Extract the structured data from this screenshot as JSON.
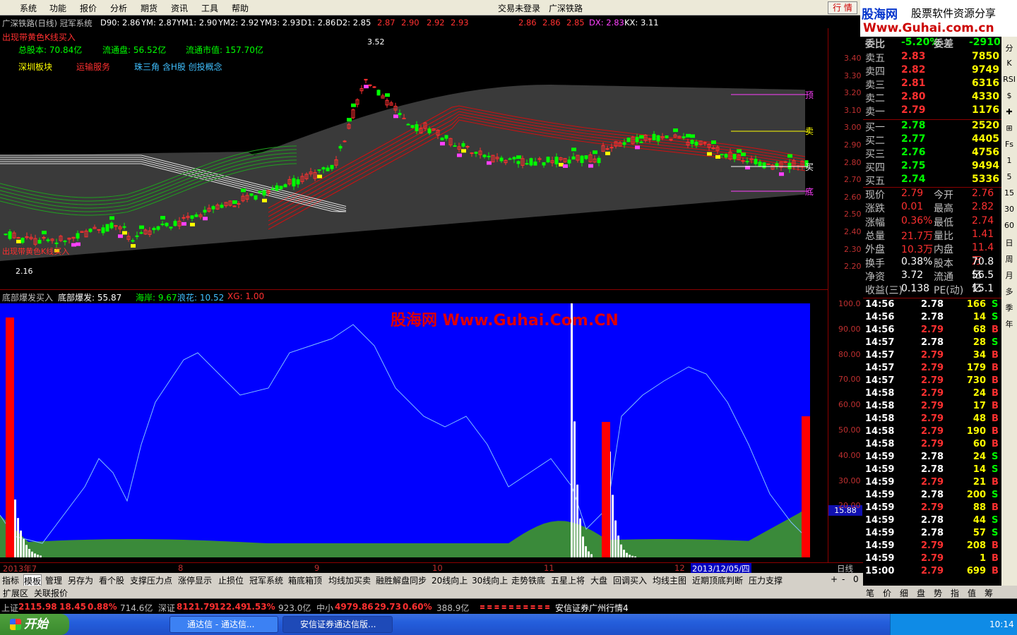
{
  "menu": {
    "items": [
      "系统",
      "功能",
      "报价",
      "分析",
      "期货",
      "资讯",
      "工具",
      "帮助"
    ],
    "status": "交易未登录",
    "stock": "广深铁路",
    "hq_button": "行 情",
    "win_buttons": "_ □ ×"
  },
  "logo": {
    "line1": "股海网",
    "line1b": "股票软件资源分享",
    "line2": "Www.Guhai.com.cn"
  },
  "chart_info": {
    "title": "广深铁路(日线) 冠军系统",
    "d90": "D90: 2.86",
    "ym": "YM: 2.87",
    "ym1": "YM1: 2.90",
    "ym2": "YM2: 2.92",
    "ym3": "YM3: 2.93",
    "d1": "D1: 2.86",
    "d2": "D2: 2.85",
    "r1": "2.87",
    "r2": "2.90",
    "r3": "2.92",
    "r4": "2.93",
    "r5": "2.86",
    "r6": "2.86",
    "r7": "2.85",
    "dx": "DX: 2.83",
    "kx": "KX: 3.11"
  },
  "chart_labels": {
    "k_alert": "出现带黄色K线买入",
    "k_alert2": "出现带黄色K线买入",
    "total_shares": "总股本: 70.84亿",
    "float_shares": "流通盘: 56.52亿",
    "float_mv": "流通市值: 157.70亿",
    "sector1": "深圳板块",
    "sector2": "运输服务",
    "concept": "珠三角 含H股 创投概念",
    "high": "3.52",
    "low": "2.16",
    "top": "顶",
    "sell": "卖",
    "buy": "买",
    "bottom": "底"
  },
  "price_axis": [
    "3.40",
    "3.30",
    "3.20",
    "3.10",
    "3.00",
    "2.90",
    "2.80",
    "2.70",
    "2.60",
    "2.50",
    "2.40",
    "2.30",
    "2.20"
  ],
  "sub_head": {
    "name": "底部爆发买入",
    "v1": "底部爆发: 55.87",
    "v2": "海岸: 9.67",
    "v3": "浪花: 10.52",
    "v4": "XG: 1.00"
  },
  "sub_axis": [
    "100.0",
    "90.00",
    "80.00",
    "70.00",
    "60.00",
    "50.00",
    "40.00",
    "30.00",
    "20.00"
  ],
  "sub_current": "15.88",
  "watermark": "股海网 Www.Guhai.Com.CN",
  "date_axis": {
    "y2013": "2013年7",
    "m8": "8",
    "m9": "9",
    "m10": "10",
    "m11": "11",
    "m12": "12",
    "cursor": "2013/12/05/四",
    "period": "日线"
  },
  "tabs": [
    "指标",
    "模板",
    "管理",
    "另存为",
    "看个股",
    "支撑压力点",
    "涨停显示",
    "止损位",
    "冠军系统",
    "箱底箱顶",
    "均线加买卖",
    "融胜解盘同步",
    "20线向上",
    "30线向上",
    "走势铁底",
    "五星上将",
    "大盘",
    "回调买入",
    "均线主图",
    "近期顶底判断",
    "压力支撑"
  ],
  "tab_ctrl": [
    "+",
    "-",
    "0"
  ],
  "expand": [
    "扩展区",
    "关联报价"
  ],
  "order_book": {
    "header": {
      "a": "委比",
      "b": "-5.20%",
      "c": "委差",
      "d": "-2910"
    },
    "sell": [
      {
        "n": "卖五",
        "p": "2.83",
        "v": "7850"
      },
      {
        "n": "卖四",
        "p": "2.82",
        "v": "9749"
      },
      {
        "n": "卖三",
        "p": "2.81",
        "v": "6316"
      },
      {
        "n": "卖二",
        "p": "2.80",
        "v": "4330"
      },
      {
        "n": "卖一",
        "p": "2.79",
        "v": "1176"
      }
    ],
    "buy": [
      {
        "n": "买一",
        "p": "2.78",
        "v": "2520"
      },
      {
        "n": "买二",
        "p": "2.77",
        "v": "4405"
      },
      {
        "n": "买三",
        "p": "2.76",
        "v": "4756"
      },
      {
        "n": "买四",
        "p": "2.75",
        "v": "9494"
      },
      {
        "n": "买五",
        "p": "2.74",
        "v": "5336"
      }
    ]
  },
  "stats": [
    {
      "a": "现价",
      "b": "2.79",
      "c": "今开",
      "d": "2.76"
    },
    {
      "a": "涨跌",
      "b": "0.01",
      "c": "最高",
      "d": "2.82"
    },
    {
      "a": "涨幅",
      "b": "0.36%",
      "c": "最低",
      "d": "2.74"
    },
    {
      "a": "总量",
      "b": "21.7万",
      "c": "量比",
      "d": "1.41"
    },
    {
      "a": "外盘",
      "b": "10.3万",
      "c": "内盘",
      "d": "11.4万"
    },
    {
      "a": "换手",
      "b": "0.38%",
      "c": "股本",
      "d": "70.8亿"
    },
    {
      "a": "净资",
      "b": "3.72",
      "c": "流通",
      "d": "56.5亿"
    },
    {
      "a": "收益(三)",
      "b": "0.138",
      "c": "PE(动)",
      "d": "15.1"
    }
  ],
  "ticks": [
    {
      "t": "14:56",
      "p": "2.78",
      "v": "166",
      "s": "S"
    },
    {
      "t": "14:56",
      "p": "2.78",
      "v": "14",
      "s": "S"
    },
    {
      "t": "14:56",
      "p": "2.79",
      "v": "68",
      "s": "B"
    },
    {
      "t": "14:57",
      "p": "2.78",
      "v": "28",
      "s": "S"
    },
    {
      "t": "14:57",
      "p": "2.79",
      "v": "34",
      "s": "B"
    },
    {
      "t": "14:57",
      "p": "2.79",
      "v": "179",
      "s": "B"
    },
    {
      "t": "14:57",
      "p": "2.79",
      "v": "730",
      "s": "B"
    },
    {
      "t": "14:58",
      "p": "2.79",
      "v": "24",
      "s": "B"
    },
    {
      "t": "14:58",
      "p": "2.79",
      "v": "17",
      "s": "B"
    },
    {
      "t": "14:58",
      "p": "2.79",
      "v": "48",
      "s": "B"
    },
    {
      "t": "14:58",
      "p": "2.79",
      "v": "190",
      "s": "B"
    },
    {
      "t": "14:58",
      "p": "2.79",
      "v": "60",
      "s": "B"
    },
    {
      "t": "14:59",
      "p": "2.78",
      "v": "24",
      "s": "S"
    },
    {
      "t": "14:59",
      "p": "2.78",
      "v": "14",
      "s": "S"
    },
    {
      "t": "14:59",
      "p": "2.79",
      "v": "21",
      "s": "B"
    },
    {
      "t": "14:59",
      "p": "2.78",
      "v": "200",
      "s": "S"
    },
    {
      "t": "14:59",
      "p": "2.79",
      "v": "88",
      "s": "B"
    },
    {
      "t": "14:59",
      "p": "2.78",
      "v": "44",
      "s": "S"
    },
    {
      "t": "14:59",
      "p": "2.78",
      "v": "57",
      "s": "S"
    },
    {
      "t": "14:59",
      "p": "2.79",
      "v": "208",
      "s": "B"
    },
    {
      "t": "14:59",
      "p": "2.79",
      "v": "1",
      "s": "B"
    },
    {
      "t": "15:00",
      "p": "2.79",
      "v": "699",
      "s": "B"
    }
  ],
  "rp_tabs": [
    "笔",
    "价",
    "细",
    "盘",
    "势",
    "指",
    "值",
    "筹"
  ],
  "sidebar": [
    "分",
    "K",
    "RSI",
    "$",
    "✚",
    "⊞",
    "Fs",
    "1",
    "5",
    "15",
    "30",
    "60",
    "日",
    "周",
    "月",
    "多",
    "季",
    "年"
  ],
  "status": {
    "sh_label": "上证",
    "sh": "2115.98",
    "sh_ch": "18.45",
    "sh_pct": "0.88%",
    "sh_amt": "714.6亿",
    "sz_label": "深证",
    "sz": "8121.79",
    "sz_ch": "122.49",
    "sz_pct": "1.53%",
    "sz_amt": "923.0亿",
    "zx_label": "中小",
    "zx": "4979.86",
    "zx_ch": "29.73",
    "zx_pct": "0.60%",
    "zx_amt": "388.9亿",
    "broker": "安信证券广州行情4"
  },
  "taskbar": {
    "start": "开始",
    "task1": "通达信 - 通达信...",
    "task2": "安信证券通达信版...",
    "clock": "10:14"
  },
  "colors": {
    "up": "#ff3030",
    "down": "#00ff00",
    "yellow": "#ffff00",
    "band": "#3a3a3a",
    "sub_bg": "#0000ff"
  }
}
